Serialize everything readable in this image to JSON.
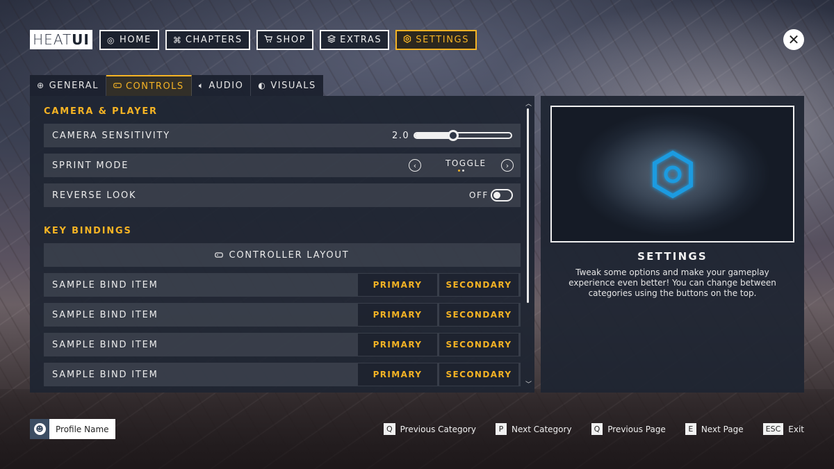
{
  "logo": {
    "part1": "HEAT",
    "part2": "UI"
  },
  "topnav": [
    {
      "label": "HOME",
      "icon": "home-icon"
    },
    {
      "label": "CHAPTERS",
      "icon": "chapters-icon"
    },
    {
      "label": "SHOP",
      "icon": "cart-icon"
    },
    {
      "label": "EXTRAS",
      "icon": "layers-icon"
    },
    {
      "label": "SETTINGS",
      "icon": "gear-icon",
      "active": true
    }
  ],
  "tabs": [
    {
      "label": "GENERAL",
      "icon": "general-icon"
    },
    {
      "label": "CONTROLS",
      "icon": "controller-icon",
      "active": true
    },
    {
      "label": "AUDIO",
      "icon": "speaker-icon"
    },
    {
      "label": "VISUALS",
      "icon": "palette-icon"
    }
  ],
  "camera_section": {
    "title": "CAMERA & PLAYER",
    "sensitivity": {
      "label": "CAMERA SENSITIVITY",
      "value": "2.0",
      "fraction": 0.4
    },
    "sprint": {
      "label": "SPRINT MODE",
      "value": "TOGGLE",
      "option_index": 0,
      "option_count": 2
    },
    "reverse_look": {
      "label": "REVERSE LOOK",
      "value": "OFF"
    }
  },
  "bindings_section": {
    "title": "KEY BINDINGS",
    "layout_button": "CONTROLLER LAYOUT",
    "items": [
      {
        "label": "SAMPLE BIND ITEM",
        "primary": "PRIMARY",
        "secondary": "SECONDARY"
      },
      {
        "label": "SAMPLE BIND ITEM",
        "primary": "PRIMARY",
        "secondary": "SECONDARY"
      },
      {
        "label": "SAMPLE BIND ITEM",
        "primary": "PRIMARY",
        "secondary": "SECONDARY"
      },
      {
        "label": "SAMPLE BIND ITEM",
        "primary": "PRIMARY",
        "secondary": "SECONDARY"
      }
    ]
  },
  "info_panel": {
    "title": "SETTINGS",
    "description": "Tweak some options and make your gameplay experience even better! You can change between categories using the buttons on the top."
  },
  "profile": {
    "name": "Profile Name"
  },
  "hints": [
    {
      "key": "Q",
      "label": "Previous Category"
    },
    {
      "key": "P",
      "label": "Next Category"
    },
    {
      "key": "Q",
      "label": "Previous Page"
    },
    {
      "key": "E",
      "label": "Next Page"
    },
    {
      "key": "ESC",
      "label": "Exit"
    }
  ],
  "colors": {
    "accent": "#f5b324",
    "preview_icon": "#1e9be0"
  }
}
